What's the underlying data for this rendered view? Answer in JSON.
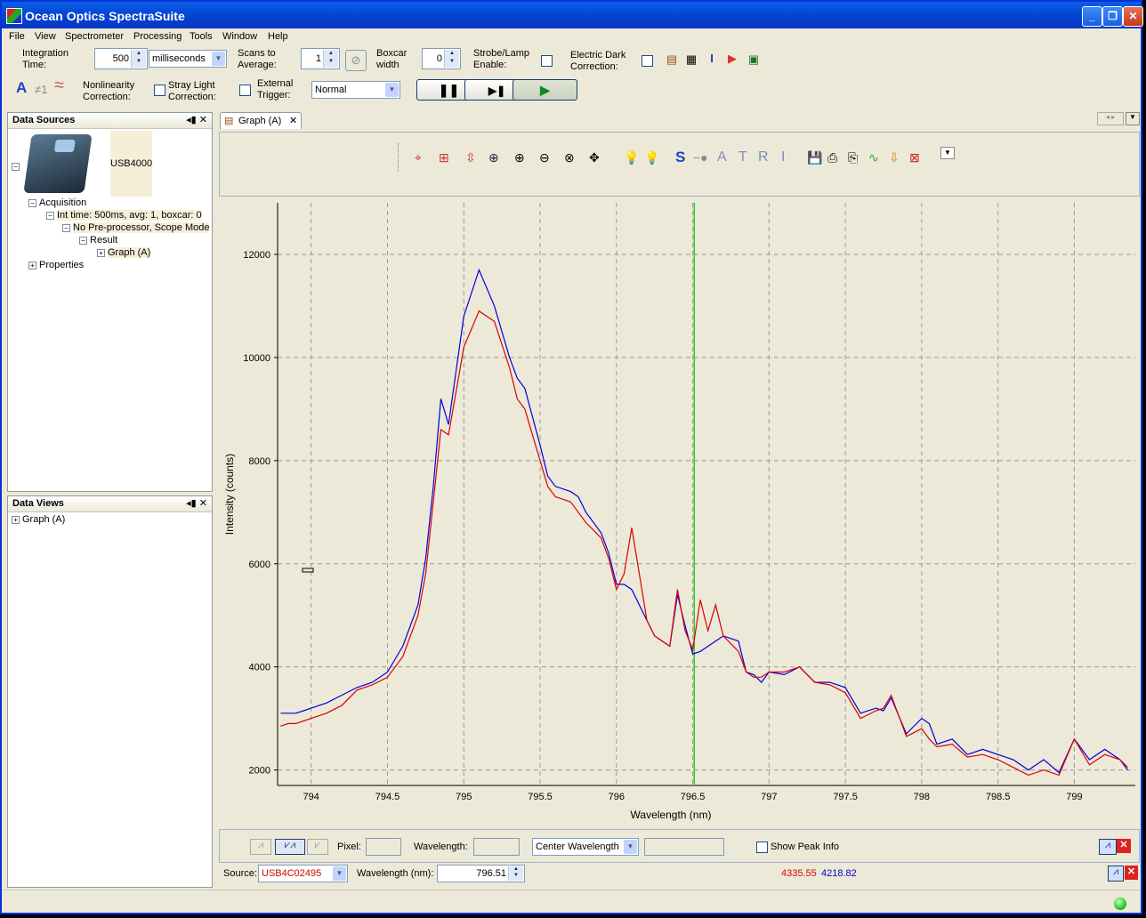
{
  "app": {
    "title": "Ocean Optics SpectraSuite"
  },
  "menu": [
    "File",
    "View",
    "Spectrometer",
    "Processing",
    "Tools",
    "Window",
    "Help"
  ],
  "toolbar": {
    "integration_time_label_1": "Integration",
    "integration_time_label_2": "Time:",
    "integration_time_value": "500",
    "integration_unit": "milliseconds",
    "scans_label_1": "Scans to",
    "scans_label_2": "Average:",
    "scans_value": "1",
    "boxcar_label_1": "Boxcar",
    "boxcar_label_2": "width",
    "boxcar_value": "0",
    "strobe_label_1": "Strobe/Lamp",
    "strobe_label_2": "Enable:",
    "dark_label_1": "Electric Dark",
    "dark_label_2": "Correction:",
    "nonlin_label_1": "Nonlinearity",
    "nonlin_label_2": "Correction:",
    "stray_label_1": "Stray Light",
    "stray_label_2": "Correction:",
    "trigger_label_1": "External",
    "trigger_label_2": "Trigger:",
    "trigger_value": "Normal",
    "icon_a": "A",
    "icon_neq": "≠1",
    "icon_wave": "≈"
  },
  "data_sources": {
    "title": "Data Sources",
    "device": "USB4000",
    "acquisition": "Acquisition",
    "int_time": "Int time: 500ms, avg: 1, boxcar: 0",
    "preproc": "No Pre-processor, Scope Mode",
    "result": "Result",
    "graph": "Graph (A)",
    "properties": "Properties"
  },
  "data_views": {
    "title": "Data Views",
    "graph": "Graph (A)"
  },
  "tab": {
    "label": "Graph (A)"
  },
  "graph_toolbar": {
    "s": "S",
    "a": "A",
    "t": "T",
    "r": "R",
    "i": "I"
  },
  "bottom": {
    "pixel_label": "Pixel:",
    "wavelength_label": "Wavelength:",
    "center_wavelength": "Center Wavelength",
    "show_peak": "Show Peak Info",
    "source_label": "Source:",
    "source_value": "USB4C02495",
    "wl_nm_label": "Wavelength (nm):",
    "wl_value": "796.51",
    "val_red": "4335.55",
    "val_blue": "4218.82"
  },
  "colors": {
    "red": "#dd0000",
    "blue": "#0000dd",
    "cursor": "#22cc22"
  },
  "chart_data": {
    "type": "line",
    "xlabel": "Wavelength (nm)",
    "ylabel": "Intensity (counts)",
    "xlim": [
      793.78,
      799.4
    ],
    "ylim": [
      1700,
      13000
    ],
    "xticks": [
      794,
      794.5,
      795,
      795.5,
      796,
      796.5,
      797,
      797.5,
      798,
      798.5,
      799
    ],
    "xtick_labels": [
      "794",
      "794.5",
      "795",
      "795.5",
      "796",
      "796.5",
      "797",
      "797.5",
      "798",
      "798.5",
      "799"
    ],
    "yticks": [
      2000,
      4000,
      6000,
      8000,
      10000,
      12000
    ],
    "ytick_labels": [
      "2000",
      "4000",
      "6000",
      "8000",
      "10000",
      "12000"
    ],
    "grid": true,
    "cursor_x": 796.51,
    "series": [
      {
        "color": "blue",
        "x": [
          793.8,
          793.85,
          793.9,
          793.95,
          794.0,
          794.1,
          794.2,
          794.3,
          794.4,
          794.5,
          794.6,
          794.7,
          794.75,
          794.8,
          794.85,
          794.9,
          795.0,
          795.1,
          795.2,
          795.3,
          795.35,
          795.4,
          795.5,
          795.55,
          795.6,
          795.7,
          795.75,
          795.8,
          795.9,
          795.95,
          796.0,
          796.05,
          796.1,
          796.2,
          796.25,
          796.3,
          796.35,
          796.4,
          796.45,
          796.5,
          796.55,
          796.6,
          796.65,
          796.7,
          796.8,
          796.85,
          796.9,
          796.95,
          797.0,
          797.1,
          797.2,
          797.3,
          797.4,
          797.5,
          797.6,
          797.7,
          797.75,
          797.8,
          797.9,
          798.0,
          798.05,
          798.1,
          798.2,
          798.3,
          798.4,
          798.5,
          798.6,
          798.7,
          798.8,
          798.9,
          799.0,
          799.1,
          799.2,
          799.3,
          799.35
        ],
        "y": [
          3100,
          3100,
          3100,
          3150,
          3200,
          3300,
          3450,
          3600,
          3700,
          3900,
          4400,
          5200,
          6100,
          7500,
          9200,
          8700,
          10800,
          11700,
          11000,
          10000,
          9600,
          9400,
          8300,
          7700,
          7500,
          7400,
          7300,
          7000,
          6600,
          6200,
          5600,
          5600,
          5500,
          4900,
          4600,
          4500,
          4400,
          5400,
          4800,
          4250,
          4300,
          4400,
          4500,
          4600,
          4500,
          3900,
          3850,
          3700,
          3900,
          3850,
          4000,
          3700,
          3700,
          3600,
          3100,
          3200,
          3150,
          3400,
          2700,
          3000,
          2900,
          2500,
          2600,
          2300,
          2400,
          2300,
          2200,
          2000,
          2200,
          1950,
          2600,
          2200,
          2400,
          2200,
          2000
        ]
      },
      {
        "color": "red",
        "x": [
          793.8,
          793.85,
          793.9,
          793.95,
          794.0,
          794.1,
          794.2,
          794.3,
          794.4,
          794.5,
          794.6,
          794.7,
          794.75,
          794.8,
          794.85,
          794.9,
          795.0,
          795.1,
          795.2,
          795.3,
          795.35,
          795.4,
          795.5,
          795.55,
          795.6,
          795.7,
          795.75,
          795.8,
          795.9,
          795.95,
          796.0,
          796.05,
          796.1,
          796.2,
          796.25,
          796.3,
          796.35,
          796.4,
          796.45,
          796.5,
          796.55,
          796.6,
          796.65,
          796.7,
          796.8,
          796.85,
          796.9,
          796.95,
          797.0,
          797.1,
          797.2,
          797.3,
          797.4,
          797.5,
          797.6,
          797.7,
          797.75,
          797.8,
          797.9,
          798.0,
          798.05,
          798.1,
          798.2,
          798.3,
          798.4,
          798.5,
          798.6,
          798.7,
          798.8,
          798.9,
          799.0,
          799.1,
          799.2,
          799.3,
          799.35
        ],
        "y": [
          2850,
          2900,
          2900,
          2950,
          3000,
          3100,
          3250,
          3550,
          3650,
          3800,
          4200,
          5000,
          5800,
          7200,
          8600,
          8500,
          10200,
          10900,
          10700,
          9800,
          9200,
          9000,
          8000,
          7500,
          7300,
          7200,
          7000,
          6800,
          6500,
          6100,
          5500,
          5800,
          6700,
          4900,
          4600,
          4500,
          4400,
          5500,
          4700,
          4335,
          5300,
          4700,
          5200,
          4600,
          4300,
          3900,
          3800,
          3800,
          3900,
          3900,
          4000,
          3700,
          3650,
          3500,
          3000,
          3150,
          3200,
          3450,
          2650,
          2800,
          2600,
          2450,
          2500,
          2250,
          2300,
          2200,
          2050,
          1900,
          2000,
          1900,
          2600,
          2100,
          2300,
          2200,
          2050
        ]
      }
    ]
  }
}
